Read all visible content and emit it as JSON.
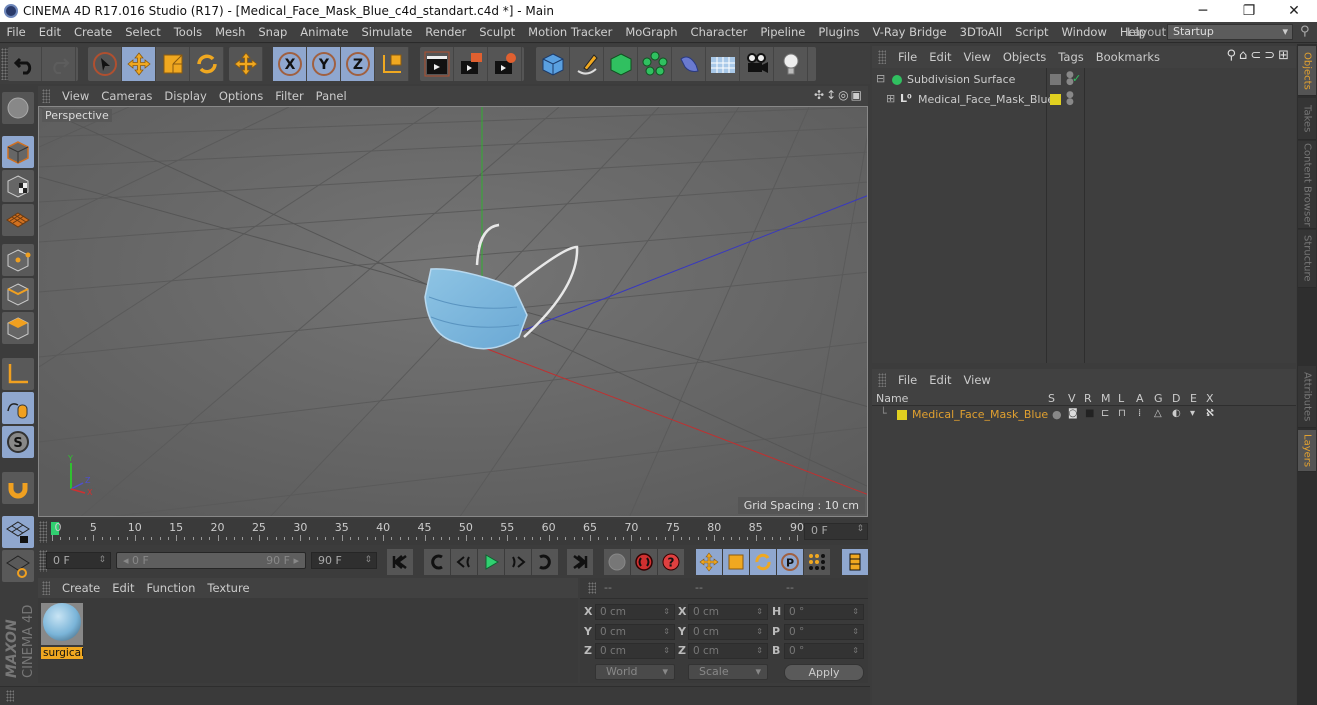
{
  "window": {
    "title": "CINEMA 4D R17.016 Studio (R17) - [Medical_Face_Mask_Blue_c4d_standart.c4d *] - Main",
    "controls": {
      "minimize": "─",
      "restore": "❐",
      "close": "✕"
    }
  },
  "menubar": {
    "items": [
      "File",
      "Edit",
      "Create",
      "Select",
      "Tools",
      "Mesh",
      "Snap",
      "Animate",
      "Simulate",
      "Render",
      "Sculpt",
      "Motion Tracker",
      "MoGraph",
      "Character",
      "Pipeline",
      "Plugins",
      "V-Ray Bridge",
      "3DToAll",
      "Script",
      "Window",
      "Help"
    ],
    "layout_label": "Layout:",
    "layout_value": "Startup"
  },
  "toolbar": {
    "icons": [
      "undo-icon",
      "redo-icon",
      "live-selection-icon",
      "move-icon",
      "scale-icon",
      "rotate-icon",
      "recent-tool-icon",
      "x-axis-lock-icon",
      "y-axis-lock-icon",
      "z-axis-lock-icon",
      "coordinate-system-icon",
      "render-view-icon",
      "render-to-picture-viewer-icon",
      "edit-render-settings-icon",
      "cube-primitive-icon",
      "pen-spline-icon",
      "subdivision-surface-icon",
      "cloner-icon",
      "deformer-icon",
      "floor-icon",
      "camera-icon",
      "light-icon"
    ]
  },
  "viewport": {
    "menu": [
      "View",
      "Cameras",
      "Display",
      "Options",
      "Filter",
      "Panel"
    ],
    "label": "Perspective",
    "grid_spacing": "Grid Spacing : 10 cm",
    "axis_colors": {
      "x": "#c03030",
      "y": "#30b030",
      "z": "#3030c0"
    }
  },
  "left_tools": [
    "make-editable-icon",
    "model-mode-icon",
    "texture-mode-icon",
    "workplane-mode-icon",
    "points-mode-icon",
    "edges-mode-icon",
    "polygons-mode-icon",
    "enable-axis-icon",
    "tweak-mode-icon",
    "solo-icon",
    "snap-icon",
    "lock-workplane-icon",
    "workplane-icon"
  ],
  "timeline": {
    "ticks": [
      "0",
      "5",
      "10",
      "15",
      "20",
      "25",
      "30",
      "35",
      "40",
      "45",
      "50",
      "55",
      "60",
      "65",
      "70",
      "75",
      "80",
      "85",
      "90"
    ],
    "current_frame": 0,
    "max_frame": 90,
    "frame_display": "0 F"
  },
  "transport": {
    "start_field": "0 F",
    "range_start": "◂ 0 F",
    "range_end": "90 F ▸",
    "end_field": "90 F",
    "buttons": [
      "go-to-start",
      "prev-key",
      "prev-frame",
      "play-forward",
      "next-frame",
      "next-key",
      "go-to-end",
      "record-disabled",
      "autokey",
      "keyframe-selection",
      "move-keys",
      "scale-keys",
      "rotate-keys",
      "param-keys",
      "pla-keys",
      "timeline-window"
    ]
  },
  "materials": {
    "menu": [
      "Create",
      "Edit",
      "Function",
      "Texture"
    ],
    "items": [
      {
        "name": "surgical"
      }
    ]
  },
  "coordinates": {
    "header": [
      "--",
      "--",
      "--"
    ],
    "rows": [
      {
        "pos_label": "X",
        "pos": "0 cm",
        "size_label": "X",
        "size": "0 cm",
        "rot_label": "H",
        "rot": "0 °"
      },
      {
        "pos_label": "Y",
        "pos": "0 cm",
        "size_label": "Y",
        "size": "0 cm",
        "rot_label": "P",
        "rot": "0 °"
      },
      {
        "pos_label": "Z",
        "pos": "0 cm",
        "size_label": "Z",
        "size": "0 cm",
        "rot_label": "B",
        "rot": "0 °"
      }
    ],
    "mode": "World",
    "size_mode": "Scale",
    "apply": "Apply"
  },
  "brand": {
    "maxon": "MAXON",
    "product": "CINEMA 4D"
  },
  "objects": {
    "menu": [
      "File",
      "Edit",
      "View",
      "Objects",
      "Tags",
      "Bookmarks"
    ],
    "tree": [
      {
        "name": "Subdivision Surface",
        "level": 0,
        "expander": "⊟",
        "checked": "✓"
      },
      {
        "name": "Medical_Face_Mask_Blue",
        "level": 1,
        "expander": "⊞",
        "layer_color": "#e0d020"
      }
    ]
  },
  "layers": {
    "menu": [
      "File",
      "Edit",
      "View"
    ],
    "columns": [
      "Name",
      "S",
      "V",
      "R",
      "M",
      "L",
      "A",
      "G",
      "D",
      "E",
      "X"
    ],
    "rows": [
      {
        "name": "Medical_Face_Mask_Blue",
        "color": "#e0d020"
      }
    ]
  },
  "side_tabs": {
    "top": [
      "Objects",
      "Takes",
      "Content Browser",
      "Structure"
    ],
    "bottom": [
      "Attributes",
      "Layers"
    ],
    "active_top": "Objects",
    "active_bottom": "Layers"
  }
}
